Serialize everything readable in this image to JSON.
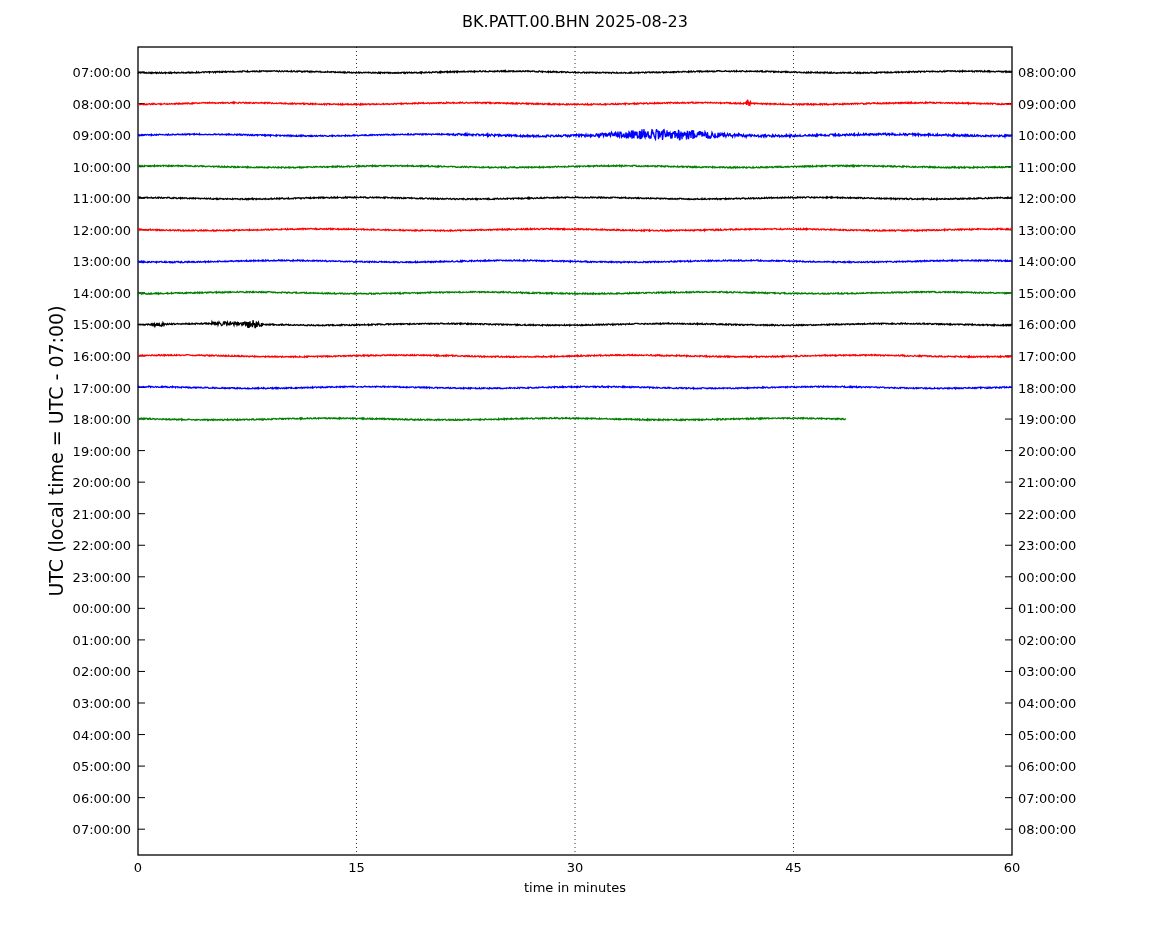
{
  "title": "BK.PATT.00.BHN 2025-08-23",
  "ylabel": "UTC (local time = UTC - 07:00)",
  "xlabel": "time in minutes",
  "xticks": [
    "0",
    "15",
    "30",
    "45",
    "60"
  ],
  "left_ticks": [
    "07:00:00",
    "08:00:00",
    "09:00:00",
    "10:00:00",
    "11:00:00",
    "12:00:00",
    "13:00:00",
    "14:00:00",
    "15:00:00",
    "16:00:00",
    "17:00:00",
    "18:00:00",
    "19:00:00",
    "20:00:00",
    "21:00:00",
    "22:00:00",
    "23:00:00",
    "00:00:00",
    "01:00:00",
    "02:00:00",
    "03:00:00",
    "04:00:00",
    "05:00:00",
    "06:00:00",
    "07:00:00"
  ],
  "right_ticks": [
    "08:00:00",
    "09:00:00",
    "10:00:00",
    "11:00:00",
    "12:00:00",
    "13:00:00",
    "14:00:00",
    "15:00:00",
    "16:00:00",
    "17:00:00",
    "18:00:00",
    "19:00:00",
    "20:00:00",
    "21:00:00",
    "22:00:00",
    "23:00:00",
    "00:00:00",
    "01:00:00",
    "02:00:00",
    "03:00:00",
    "04:00:00",
    "05:00:00",
    "06:00:00",
    "07:00:00",
    "08:00:00"
  ],
  "traces": [
    {
      "color": "#000000",
      "kind": "quiet",
      "level": 1
    },
    {
      "color": "#ff0000",
      "kind": "spike",
      "level": 1
    },
    {
      "color": "#0000ff",
      "kind": "quake",
      "level": 1
    },
    {
      "color": "#008000",
      "kind": "quiet",
      "level": 1
    },
    {
      "color": "#000000",
      "kind": "quiet",
      "level": 1
    },
    {
      "color": "#ff0000",
      "kind": "quiet",
      "level": 1
    },
    {
      "color": "#0000ff",
      "kind": "quiet",
      "level": 1
    },
    {
      "color": "#008000",
      "kind": "quiet",
      "level": 1
    },
    {
      "color": "#000000",
      "kind": "burst",
      "level": 1
    },
    {
      "color": "#ff0000",
      "kind": "quiet",
      "level": 1
    },
    {
      "color": "#0000ff",
      "kind": "quiet",
      "level": 1
    },
    {
      "color": "#008000",
      "kind": "quiet",
      "level": 0.81
    }
  ]
}
